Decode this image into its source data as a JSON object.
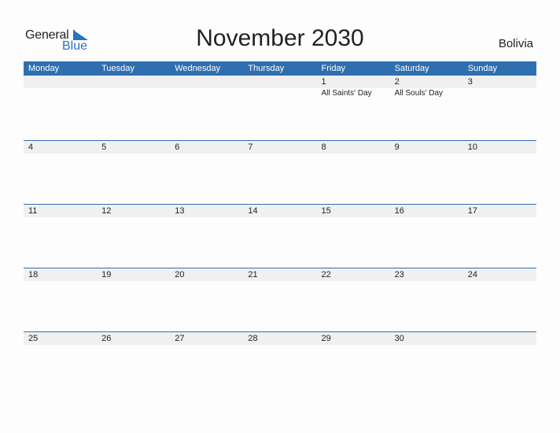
{
  "logo": {
    "general": "General",
    "blue": "Blue"
  },
  "title": "November 2030",
  "country": "Bolivia",
  "colors": {
    "accent": "#2f6fb0",
    "strip": "#f0f0f0"
  },
  "weekdays": [
    "Monday",
    "Tuesday",
    "Wednesday",
    "Thursday",
    "Friday",
    "Saturday",
    "Sunday"
  ],
  "weeks": [
    {
      "days": [
        {
          "n": "",
          "h": ""
        },
        {
          "n": "",
          "h": ""
        },
        {
          "n": "",
          "h": ""
        },
        {
          "n": "",
          "h": ""
        },
        {
          "n": "1",
          "h": "All Saints' Day"
        },
        {
          "n": "2",
          "h": "All Souls' Day"
        },
        {
          "n": "3",
          "h": ""
        }
      ]
    },
    {
      "days": [
        {
          "n": "4",
          "h": ""
        },
        {
          "n": "5",
          "h": ""
        },
        {
          "n": "6",
          "h": ""
        },
        {
          "n": "7",
          "h": ""
        },
        {
          "n": "8",
          "h": ""
        },
        {
          "n": "9",
          "h": ""
        },
        {
          "n": "10",
          "h": ""
        }
      ]
    },
    {
      "days": [
        {
          "n": "11",
          "h": ""
        },
        {
          "n": "12",
          "h": ""
        },
        {
          "n": "13",
          "h": ""
        },
        {
          "n": "14",
          "h": ""
        },
        {
          "n": "15",
          "h": ""
        },
        {
          "n": "16",
          "h": ""
        },
        {
          "n": "17",
          "h": ""
        }
      ]
    },
    {
      "days": [
        {
          "n": "18",
          "h": ""
        },
        {
          "n": "19",
          "h": ""
        },
        {
          "n": "20",
          "h": ""
        },
        {
          "n": "21",
          "h": ""
        },
        {
          "n": "22",
          "h": ""
        },
        {
          "n": "23",
          "h": ""
        },
        {
          "n": "24",
          "h": ""
        }
      ]
    },
    {
      "days": [
        {
          "n": "25",
          "h": ""
        },
        {
          "n": "26",
          "h": ""
        },
        {
          "n": "27",
          "h": ""
        },
        {
          "n": "28",
          "h": ""
        },
        {
          "n": "29",
          "h": ""
        },
        {
          "n": "30",
          "h": ""
        },
        {
          "n": "",
          "h": ""
        }
      ]
    }
  ]
}
